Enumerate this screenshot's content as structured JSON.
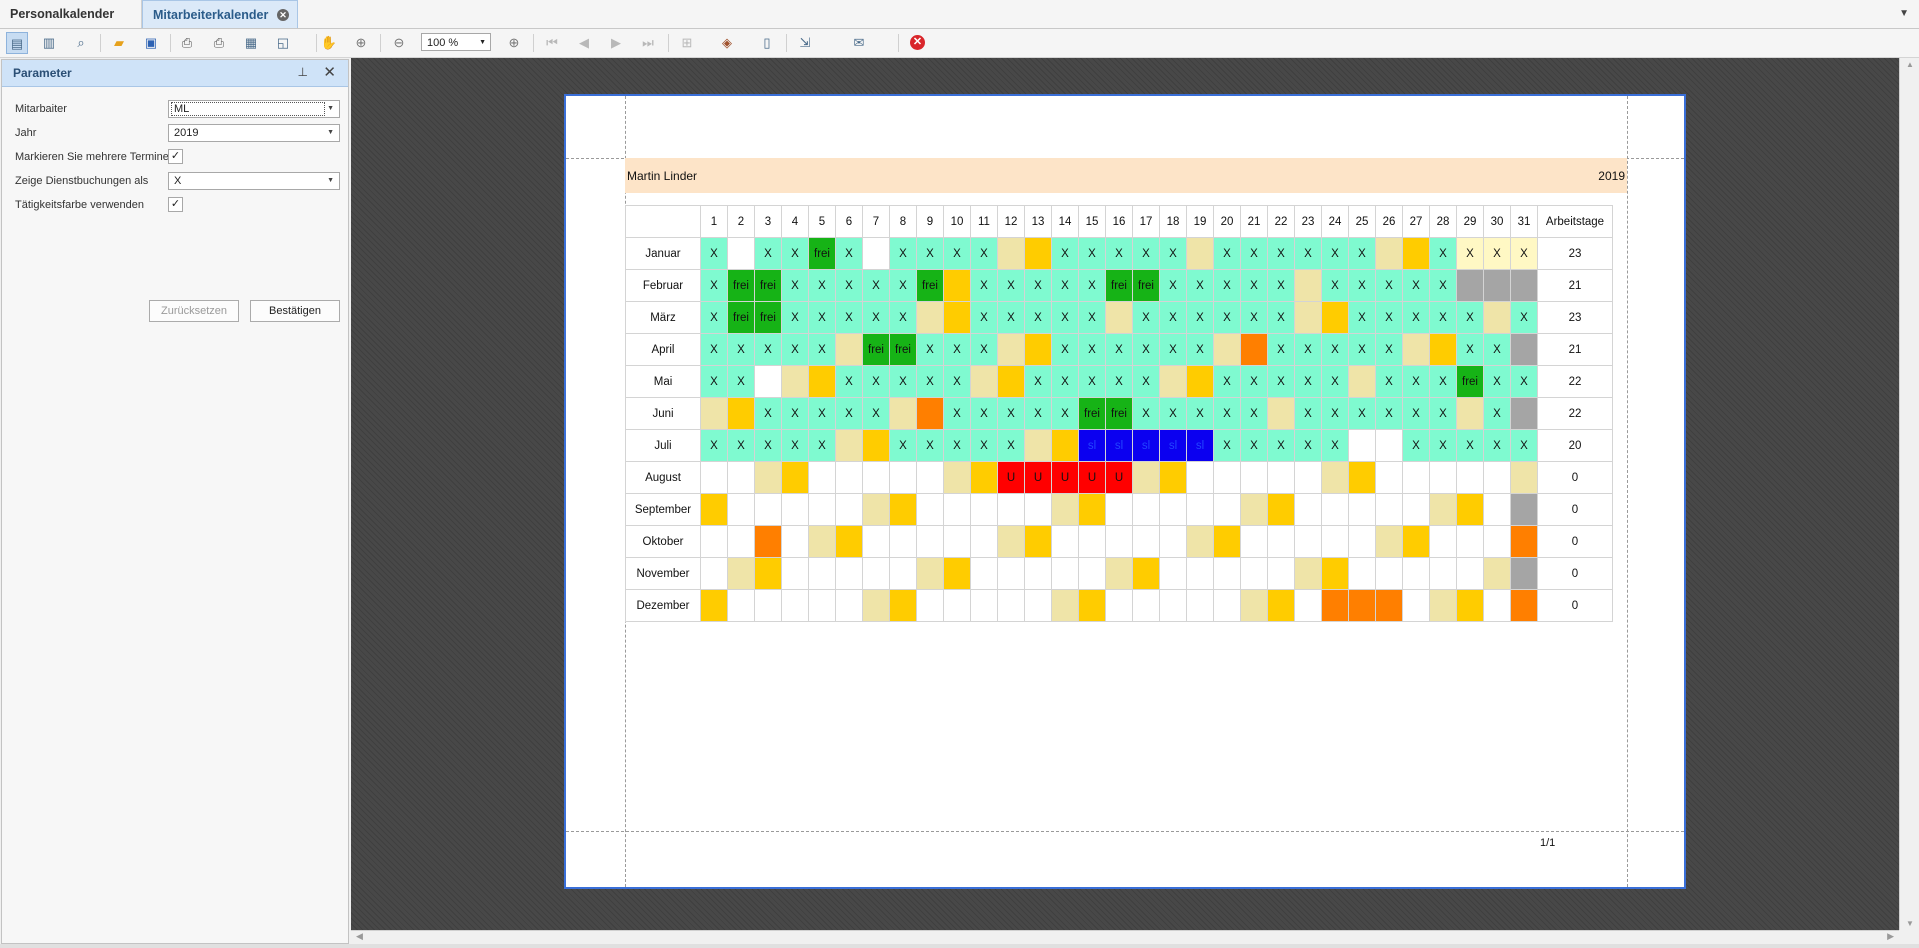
{
  "tabs": [
    {
      "label": "Personalkalender",
      "active": false
    },
    {
      "label": "Mitarbeiterkalender",
      "active": true
    }
  ],
  "toolbar": {
    "zoom": "100 %",
    "icons": [
      "parameters-icon",
      "document-map-icon",
      "search-icon",
      "open-icon",
      "save-icon",
      "print-icon",
      "quick-print-icon",
      "page-setup-icon",
      "scale-icon",
      "hand-tool-icon",
      "magnifier-icon",
      "zoom-out-icon",
      "zoom-in-icon",
      "first-page-icon",
      "previous-page-icon",
      "next-page-icon",
      "last-page-icon",
      "multiple-pages-icon",
      "background-color-icon",
      "watermark-icon",
      "export-icon",
      "send-email-icon",
      "close-preview-icon"
    ]
  },
  "panel": {
    "title": "Parameter",
    "fields": {
      "employee": {
        "label": "Mitarbaiter",
        "value": "ML"
      },
      "year": {
        "label": "Jahr",
        "value": "2019"
      },
      "mark_multiple": {
        "label": "Markieren Sie mehrere Termine",
        "checked": true
      },
      "show_bookings": {
        "label": "Zeige Dienstbuchungen als",
        "value": "X"
      },
      "activity_color": {
        "label": "Tätigkeitsfarbe verwenden",
        "checked": true
      }
    },
    "reset_label": "Zurücksetzen",
    "confirm_label": "Bestätigen"
  },
  "report": {
    "employee_name": "Martin Linder",
    "year": "2019",
    "page_number": "1/1",
    "total_header": "Arbeitstage",
    "days": [
      "1",
      "2",
      "3",
      "4",
      "5",
      "6",
      "7",
      "8",
      "9",
      "10",
      "11",
      "12",
      "13",
      "14",
      "15",
      "16",
      "17",
      "18",
      "19",
      "20",
      "21",
      "22",
      "23",
      "24",
      "25",
      "26",
      "27",
      "28",
      "29",
      "30",
      "31"
    ],
    "legend_colors": {
      "t": "#7ffad0",
      "g": "#16b316",
      "w": "#ffffff",
      "b": "#efe4a8",
      "y": "#ffcc00",
      "o": "#ff7f00",
      "r": "#ff0000",
      "u": "#0b00f0",
      "s": "#a5a5a5",
      "l": "#fff8c4"
    },
    "months": [
      {
        "name": "Januar",
        "total": "23",
        "colors": [
          "t",
          "w",
          "t",
          "t",
          "g",
          "t",
          "w",
          "t",
          "t",
          "t",
          "t",
          "b",
          "y",
          "t",
          "t",
          "t",
          "t",
          "t",
          "b",
          "t",
          "t",
          "t",
          "t",
          "t",
          "t",
          "b",
          "y",
          "t",
          "l",
          "l",
          "l"
        ],
        "texts": [
          "X",
          "",
          "X",
          "X",
          "frei",
          "X",
          "",
          "X",
          "X",
          "X",
          "X",
          "",
          "",
          "X",
          "X",
          "X",
          "X",
          "X",
          "",
          "X",
          "X",
          "X",
          "X",
          "X",
          "X",
          "",
          "",
          "X",
          "X",
          "X",
          "X"
        ]
      },
      {
        "name": "Februar",
        "total": "21",
        "colors": [
          "t",
          "g",
          "g",
          "t",
          "t",
          "t",
          "t",
          "t",
          "g",
          "y",
          "t",
          "t",
          "t",
          "t",
          "t",
          "g",
          "g",
          "t",
          "t",
          "t",
          "t",
          "t",
          "b",
          "t",
          "t",
          "t",
          "t",
          "t",
          "s",
          "s",
          "s"
        ],
        "texts": [
          "X",
          "frei",
          "frei",
          "X",
          "X",
          "X",
          "X",
          "X",
          "frei",
          "",
          "X",
          "X",
          "X",
          "X",
          "X",
          "frei",
          "frei",
          "X",
          "X",
          "X",
          "X",
          "X",
          "",
          "X",
          "X",
          "X",
          "X",
          "X",
          "",
          "",
          ""
        ]
      },
      {
        "name": "März",
        "total": "23",
        "colors": [
          "t",
          "g",
          "g",
          "t",
          "t",
          "t",
          "t",
          "t",
          "b",
          "y",
          "t",
          "t",
          "t",
          "t",
          "t",
          "b",
          "t",
          "t",
          "t",
          "t",
          "t",
          "t",
          "b",
          "y",
          "t",
          "t",
          "t",
          "t",
          "t",
          "b",
          "t"
        ],
        "texts": [
          "X",
          "frei",
          "frei",
          "X",
          "X",
          "X",
          "X",
          "X",
          "",
          "",
          "X",
          "X",
          "X",
          "X",
          "X",
          "",
          "X",
          "X",
          "X",
          "X",
          "X",
          "X",
          "",
          "",
          "X",
          "X",
          "X",
          "X",
          "X",
          "",
          "X"
        ]
      },
      {
        "name": "April",
        "total": "21",
        "colors": [
          "t",
          "t",
          "t",
          "t",
          "t",
          "b",
          "g",
          "g",
          "t",
          "t",
          "t",
          "b",
          "y",
          "t",
          "t",
          "t",
          "t",
          "t",
          "t",
          "b",
          "o",
          "t",
          "t",
          "t",
          "t",
          "t",
          "b",
          "y",
          "t",
          "t",
          "s"
        ],
        "texts": [
          "X",
          "X",
          "X",
          "X",
          "X",
          "",
          "frei",
          "frei",
          "X",
          "X",
          "X",
          "",
          "",
          "X",
          "X",
          "X",
          "X",
          "X",
          "X",
          "",
          "",
          "X",
          "X",
          "X",
          "X",
          "X",
          "",
          "",
          "X",
          "X",
          ""
        ]
      },
      {
        "name": "Mai",
        "total": "22",
        "colors": [
          "t",
          "t",
          "w",
          "b",
          "y",
          "t",
          "t",
          "t",
          "t",
          "t",
          "b",
          "y",
          "t",
          "t",
          "t",
          "t",
          "t",
          "b",
          "y",
          "t",
          "t",
          "t",
          "t",
          "t",
          "b",
          "t",
          "t",
          "t",
          "g",
          "t",
          "t"
        ],
        "texts": [
          "X",
          "X",
          "",
          "",
          "",
          "X",
          "X",
          "X",
          "X",
          "X",
          "",
          "",
          "X",
          "X",
          "X",
          "X",
          "X",
          "",
          "",
          "X",
          "X",
          "X",
          "X",
          "X",
          "",
          "X",
          "X",
          "X",
          "frei",
          "X",
          "X"
        ]
      },
      {
        "name": "Juni",
        "total": "22",
        "colors": [
          "b",
          "y",
          "t",
          "t",
          "t",
          "t",
          "t",
          "b",
          "o",
          "t",
          "t",
          "t",
          "t",
          "t",
          "g",
          "g",
          "t",
          "t",
          "t",
          "t",
          "t",
          "b",
          "t",
          "t",
          "t",
          "t",
          "t",
          "t",
          "b",
          "t",
          "s"
        ],
        "texts": [
          "",
          "",
          "X",
          "X",
          "X",
          "X",
          "X",
          "",
          "",
          "X",
          "X",
          "X",
          "X",
          "X",
          "frei",
          "frei",
          "X",
          "X",
          "X",
          "X",
          "X",
          "",
          "X",
          "X",
          "X",
          "X",
          "X",
          "X",
          "",
          "X",
          ""
        ]
      },
      {
        "name": "Juli",
        "total": "20",
        "colors": [
          "t",
          "t",
          "t",
          "t",
          "t",
          "b",
          "y",
          "t",
          "t",
          "t",
          "t",
          "t",
          "b",
          "y",
          "u",
          "u",
          "u",
          "u",
          "u",
          "t",
          "t",
          "t",
          "t",
          "t",
          "w",
          "w",
          "t",
          "t",
          "t",
          "t",
          "t"
        ],
        "texts": [
          "X",
          "X",
          "X",
          "X",
          "X",
          "",
          "",
          "X",
          "X",
          "X",
          "X",
          "X",
          "",
          "",
          "sl",
          "sl",
          "sl",
          "sl",
          "sl",
          "X",
          "X",
          "X",
          "X",
          "X",
          "",
          "",
          "X",
          "X",
          "X",
          "X",
          "X"
        ]
      },
      {
        "name": "August",
        "total": "0",
        "colors": [
          "w",
          "w",
          "b",
          "y",
          "w",
          "w",
          "w",
          "w",
          "w",
          "b",
          "y",
          "r",
          "r",
          "r",
          "r",
          "r",
          "b",
          "y",
          "w",
          "w",
          "w",
          "w",
          "w",
          "b",
          "y",
          "w",
          "w",
          "w",
          "w",
          "w",
          "b"
        ],
        "texts": [
          "",
          "",
          "",
          "",
          "",
          "",
          "",
          "",
          "",
          "",
          "",
          "U",
          "U",
          "U",
          "U",
          "U",
          "",
          "",
          "",
          "",
          "",
          "",
          "",
          "",
          "",
          "",
          "",
          "",
          "",
          "",
          ""
        ]
      },
      {
        "name": "September",
        "total": "0",
        "colors": [
          "y",
          "w",
          "w",
          "w",
          "w",
          "w",
          "b",
          "y",
          "w",
          "w",
          "w",
          "w",
          "w",
          "b",
          "y",
          "w",
          "w",
          "w",
          "w",
          "w",
          "b",
          "y",
          "w",
          "w",
          "w",
          "w",
          "w",
          "b",
          "y",
          "w",
          "s"
        ],
        "texts": [
          "",
          "",
          "",
          "",
          "",
          "",
          "",
          "",
          "",
          "",
          "",
          "",
          "",
          "",
          "",
          "",
          "",
          "",
          "",
          "",
          "",
          "",
          "",
          "",
          "",
          "",
          "",
          "",
          "",
          "",
          ""
        ]
      },
      {
        "name": "Oktober",
        "total": "0",
        "colors": [
          "w",
          "w",
          "o",
          "w",
          "b",
          "y",
          "w",
          "w",
          "w",
          "w",
          "w",
          "b",
          "y",
          "w",
          "w",
          "w",
          "w",
          "w",
          "b",
          "y",
          "w",
          "w",
          "w",
          "w",
          "w",
          "b",
          "y",
          "w",
          "w",
          "w",
          "o"
        ],
        "texts": [
          "",
          "",
          "",
          "",
          "",
          "",
          "",
          "",
          "",
          "",
          "",
          "",
          "",
          "",
          "",
          "",
          "",
          "",
          "",
          "",
          "",
          "",
          "",
          "",
          "",
          "",
          "",
          "",
          "",
          "",
          ""
        ]
      },
      {
        "name": "November",
        "total": "0",
        "colors": [
          "w",
          "b",
          "y",
          "w",
          "w",
          "w",
          "w",
          "w",
          "b",
          "y",
          "w",
          "w",
          "w",
          "w",
          "w",
          "b",
          "y",
          "w",
          "w",
          "w",
          "w",
          "w",
          "b",
          "y",
          "w",
          "w",
          "w",
          "w",
          "w",
          "b",
          "s"
        ],
        "texts": [
          "",
          "",
          "",
          "",
          "",
          "",
          "",
          "",
          "",
          "",
          "",
          "",
          "",
          "",
          "",
          "",
          "",
          "",
          "",
          "",
          "",
          "",
          "",
          "",
          "",
          "",
          "",
          "",
          "",
          "",
          ""
        ]
      },
      {
        "name": "Dezember",
        "total": "0",
        "colors": [
          "y",
          "w",
          "w",
          "w",
          "w",
          "w",
          "b",
          "y",
          "w",
          "w",
          "w",
          "w",
          "w",
          "b",
          "y",
          "w",
          "w",
          "w",
          "w",
          "w",
          "b",
          "y",
          "w",
          "o",
          "o",
          "o",
          "w",
          "b",
          "y",
          "w",
          "o"
        ],
        "texts": [
          "",
          "",
          "",
          "",
          "",
          "",
          "",
          "",
          "",
          "",
          "",
          "",
          "",
          "",
          "",
          "",
          "",
          "",
          "",
          "",
          "",
          "",
          "",
          "",
          "",
          "",
          "",
          "",
          "",
          "",
          ""
        ]
      }
    ]
  }
}
